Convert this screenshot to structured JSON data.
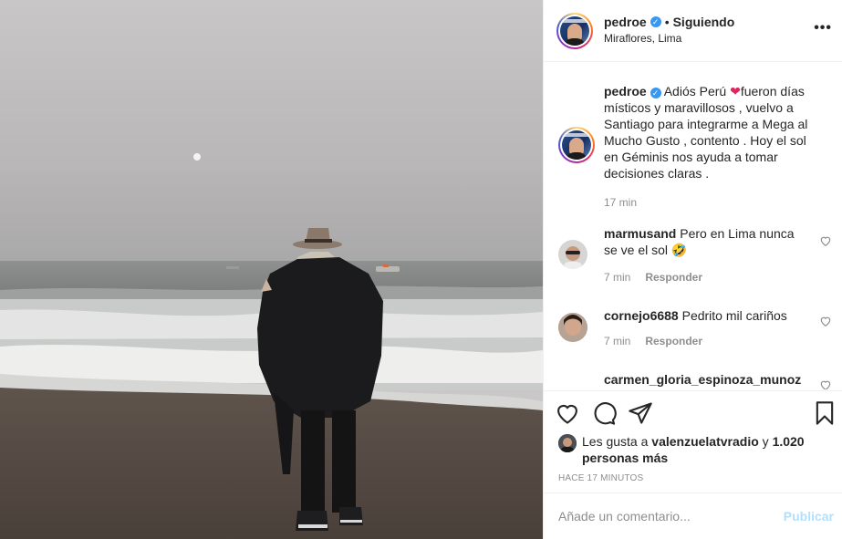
{
  "header": {
    "username": "pedroe",
    "separator": "•",
    "follow_status": "Siguiendo",
    "location": "Miraflores, Lima",
    "more_label": "•••"
  },
  "caption": {
    "username": "pedroe",
    "text_before_emoji": "Adiós Perú ",
    "emoji": "❤",
    "text_after_emoji": "fueron días místicos y maravillosos , vuelvo a Santiago para integrarme a Mega al Mucho Gusto , contento . Hoy el sol en Géminis nos ayuda a tomar decisiones claras .",
    "time": "17 min"
  },
  "comments": [
    {
      "username": "marmusand",
      "text": "Pero en Lima nunca se ve el sol 🤣",
      "time": "7 min",
      "reply": "Responder"
    },
    {
      "username": "cornejo6688",
      "text": "Pedrito mil cariños",
      "time": "7 min",
      "reply": "Responder"
    },
    {
      "username": "carmen_gloria_espinoza_munoz",
      "text": ""
    }
  ],
  "likes": {
    "prefix": "Les gusta a ",
    "user": "valenzuelatvradio",
    "middle": " y ",
    "count": "1.020 personas más"
  },
  "posted_ago": "HACE 17 MINUTOS",
  "add_comment": {
    "placeholder": "Añade un comentario...",
    "publish_label": "Publicar"
  },
  "colors": {
    "verified": "#3897f0",
    "publish_disabled": "#b2dffc",
    "muted": "#8e8e8e"
  }
}
